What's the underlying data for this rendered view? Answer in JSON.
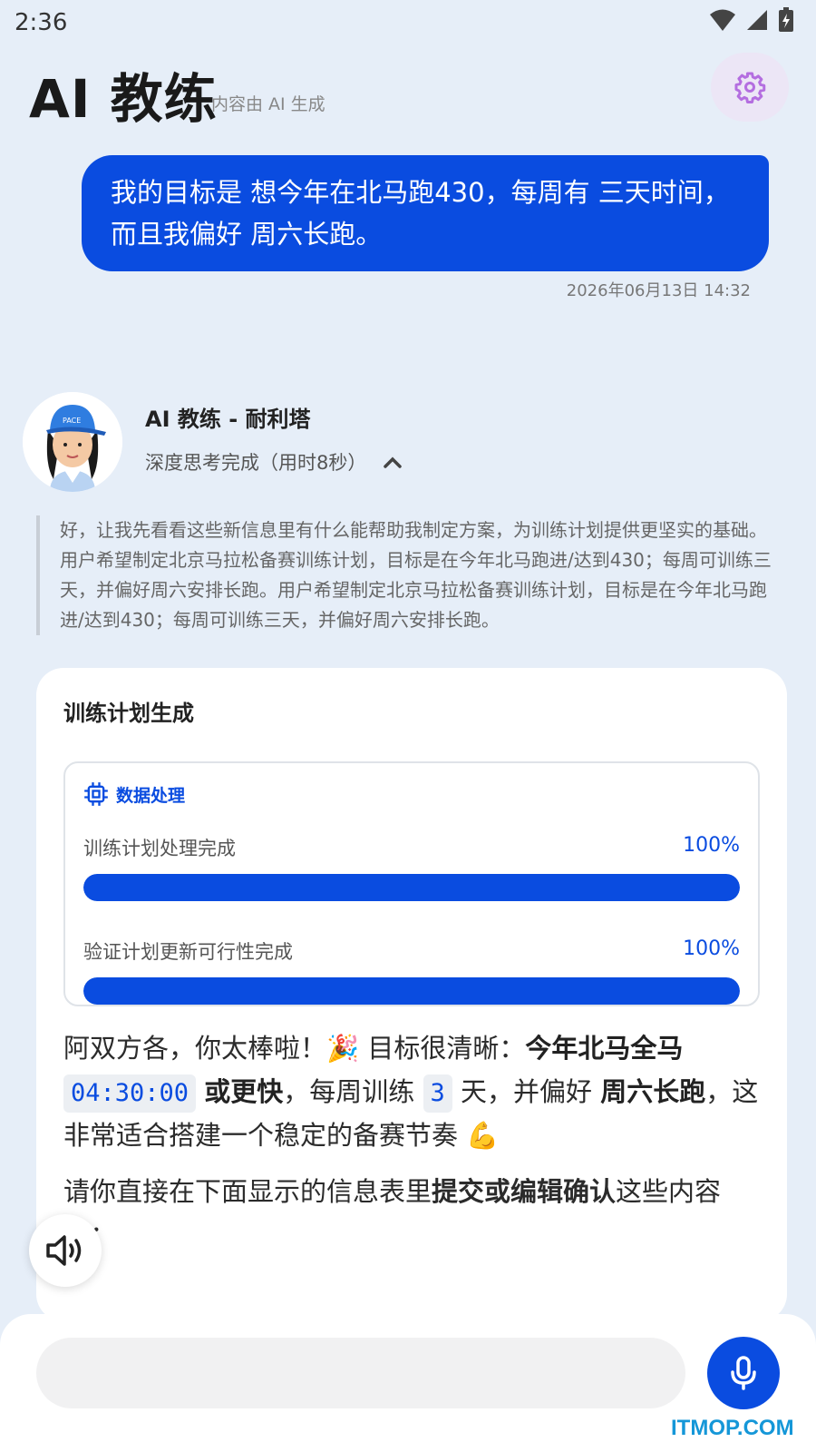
{
  "status_bar": {
    "time": "2:36"
  },
  "header": {
    "title": "AI 教练",
    "subtitle": "内容由 AI 生成"
  },
  "user_message": {
    "text": "我的目标是 想今年在北马跑430，每周有 三天时间，而且我偏好 周六长跑。",
    "timestamp": "2026年06月13日 14:32"
  },
  "ai": {
    "name": "AI 教练 - 耐利塔",
    "thinking_status": "深度思考完成（用时8秒）",
    "thinking_text": "好，让我先看看这些新信息里有什么能帮助我制定方案，为训练计划提供更坚实的基础。用户希望制定北京马拉松备赛训练计划，目标是在今年北马跑进/达到430；每周可训练三天，并偏好周六安排长跑。用户希望制定北京马拉松备赛训练计划，目标是在今年北马跑进/达到430；每周可训练三天，并偏好周六安排长跑。"
  },
  "card": {
    "title": "训练计划生成",
    "process": {
      "header": "数据处理",
      "items": [
        {
          "label": "训练计划处理完成",
          "percent_label": "100%",
          "value": 100
        },
        {
          "label": "验证计划更新可行性完成",
          "percent_label": "100%",
          "value": 100
        }
      ]
    },
    "reply": {
      "p1_a": "阿双方各，你太棒啦！",
      "p1_emoji": "🎉",
      "p1_b": " 目标很清晰：",
      "p1_bold1": "今年北马全马",
      "p1_code1": "04:30:00",
      "p1_bold2": "或更快",
      "p1_c": "，每周训练 ",
      "p1_code2": "3",
      "p1_d": " 天，并偏好 ",
      "p1_bold3": "周六长跑",
      "p1_e": "，这非常适合搭建一个稳定的备赛节奏 ",
      "p1_emoji2": "💪",
      "p2_a": "请你直接在下面显示的信息表里",
      "p2_bold": "提交或编辑确认",
      "p2_b": "这些内容呀："
    }
  },
  "input": {
    "placeholder": "",
    "value": ""
  },
  "watermark": "ITMOP.COM",
  "colors": {
    "primary": "#0a4ce0",
    "background": "#e6eef8",
    "settings_bg": "#ece6f6",
    "settings_icon": "#b46ee0"
  }
}
